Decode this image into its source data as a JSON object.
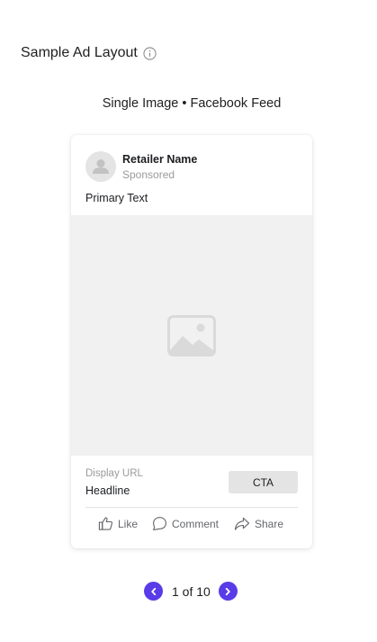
{
  "header": {
    "title": "Sample Ad Layout",
    "info_icon": "info-circle-icon"
  },
  "preview": {
    "format_label": "Single Image • Facebook Feed"
  },
  "ad": {
    "retailer_name": "Retailer Name",
    "sponsored_label": "Sponsored",
    "primary_text": "Primary Text",
    "media_icon": "image-placeholder-icon",
    "display_url": "Display URL",
    "headline": "Headline",
    "cta_label": "CTA",
    "actions": [
      {
        "label": "Like",
        "icon": "thumbs-up-icon"
      },
      {
        "label": "Comment",
        "icon": "comment-bubble-icon"
      },
      {
        "label": "Share",
        "icon": "share-arrow-icon"
      }
    ]
  },
  "pagination": {
    "text": "1 of 10",
    "current": 1,
    "total": 10
  },
  "colors": {
    "accent": "#5a3be8",
    "placeholder_bg": "#f1f1f1",
    "muted_text": "#9a9a9a",
    "cta_bg": "#e4e4e4"
  }
}
